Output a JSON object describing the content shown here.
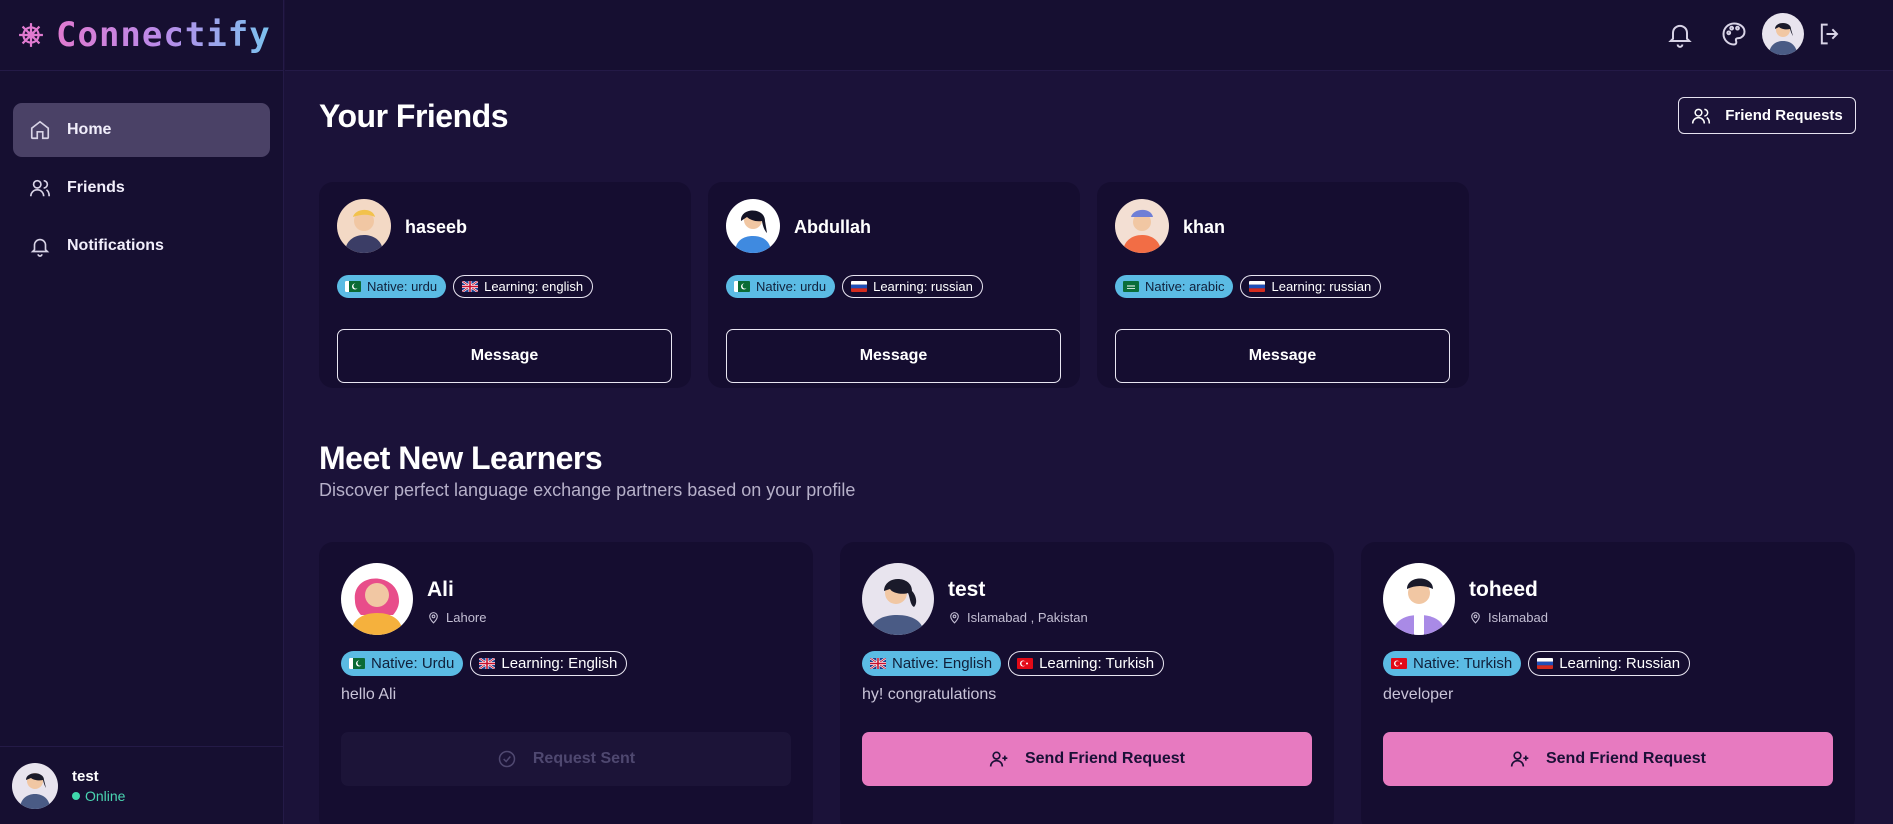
{
  "brand": {
    "name": "Connectify",
    "icon": "ship-wheel-icon",
    "gradient": [
      "#e07ad0",
      "#7bc2ee"
    ]
  },
  "sidebar": {
    "items": [
      {
        "label": "Home",
        "icon": "home-icon",
        "active": true
      },
      {
        "label": "Friends",
        "icon": "users-icon",
        "active": false
      },
      {
        "label": "Notifications",
        "icon": "bell-icon",
        "active": false
      }
    ],
    "user": {
      "name": "test",
      "status": "Online"
    }
  },
  "header": {
    "icons": [
      "bell-icon",
      "palette-icon",
      "avatar",
      "logout-icon"
    ]
  },
  "friends_section": {
    "title": "Your Friends",
    "requests_button": "Friend Requests",
    "friends": [
      {
        "name": "haseeb",
        "native": "Native: urdu",
        "learning": "Learning: english",
        "native_flag": "pk",
        "learning_flag": "gb",
        "button": "Message"
      },
      {
        "name": "Abdullah",
        "native": "Native: urdu",
        "learning": "Learning: russian",
        "native_flag": "pk",
        "learning_flag": "ru",
        "button": "Message"
      },
      {
        "name": "khan",
        "native": "Native: arabic",
        "learning": "Learning: russian",
        "native_flag": "sa",
        "learning_flag": "ru",
        "button": "Message"
      }
    ]
  },
  "learners_section": {
    "title": "Meet New Learners",
    "subtitle": "Discover perfect language exchange partners based on your profile",
    "learners": [
      {
        "name": "Ali",
        "location": "Lahore",
        "native": "Native: Urdu",
        "learning": "Learning: English",
        "native_flag": "pk",
        "learning_flag": "gb",
        "bio": "hello Ali",
        "button": "Request Sent",
        "sent": true
      },
      {
        "name": "test",
        "location": "Islamabad , Pakistan",
        "native": "Native: English",
        "learning": "Learning: Turkish",
        "native_flag": "gb",
        "learning_flag": "tr",
        "bio": "hy! congratulations",
        "button": "Send Friend Request",
        "sent": false
      },
      {
        "name": "toheed",
        "location": "Islamabad",
        "native": "Native: Turkish",
        "learning": "Learning: Russian",
        "native_flag": "tr",
        "learning_flag": "ru",
        "bio": "developer",
        "button": "Send Friend Request",
        "sent": false
      }
    ]
  },
  "colors": {
    "background": "#1b1239",
    "card": "#150d30",
    "accent": "#e77ac0",
    "native_badge": "#5bbbe4",
    "online": "#3fd8ad"
  }
}
